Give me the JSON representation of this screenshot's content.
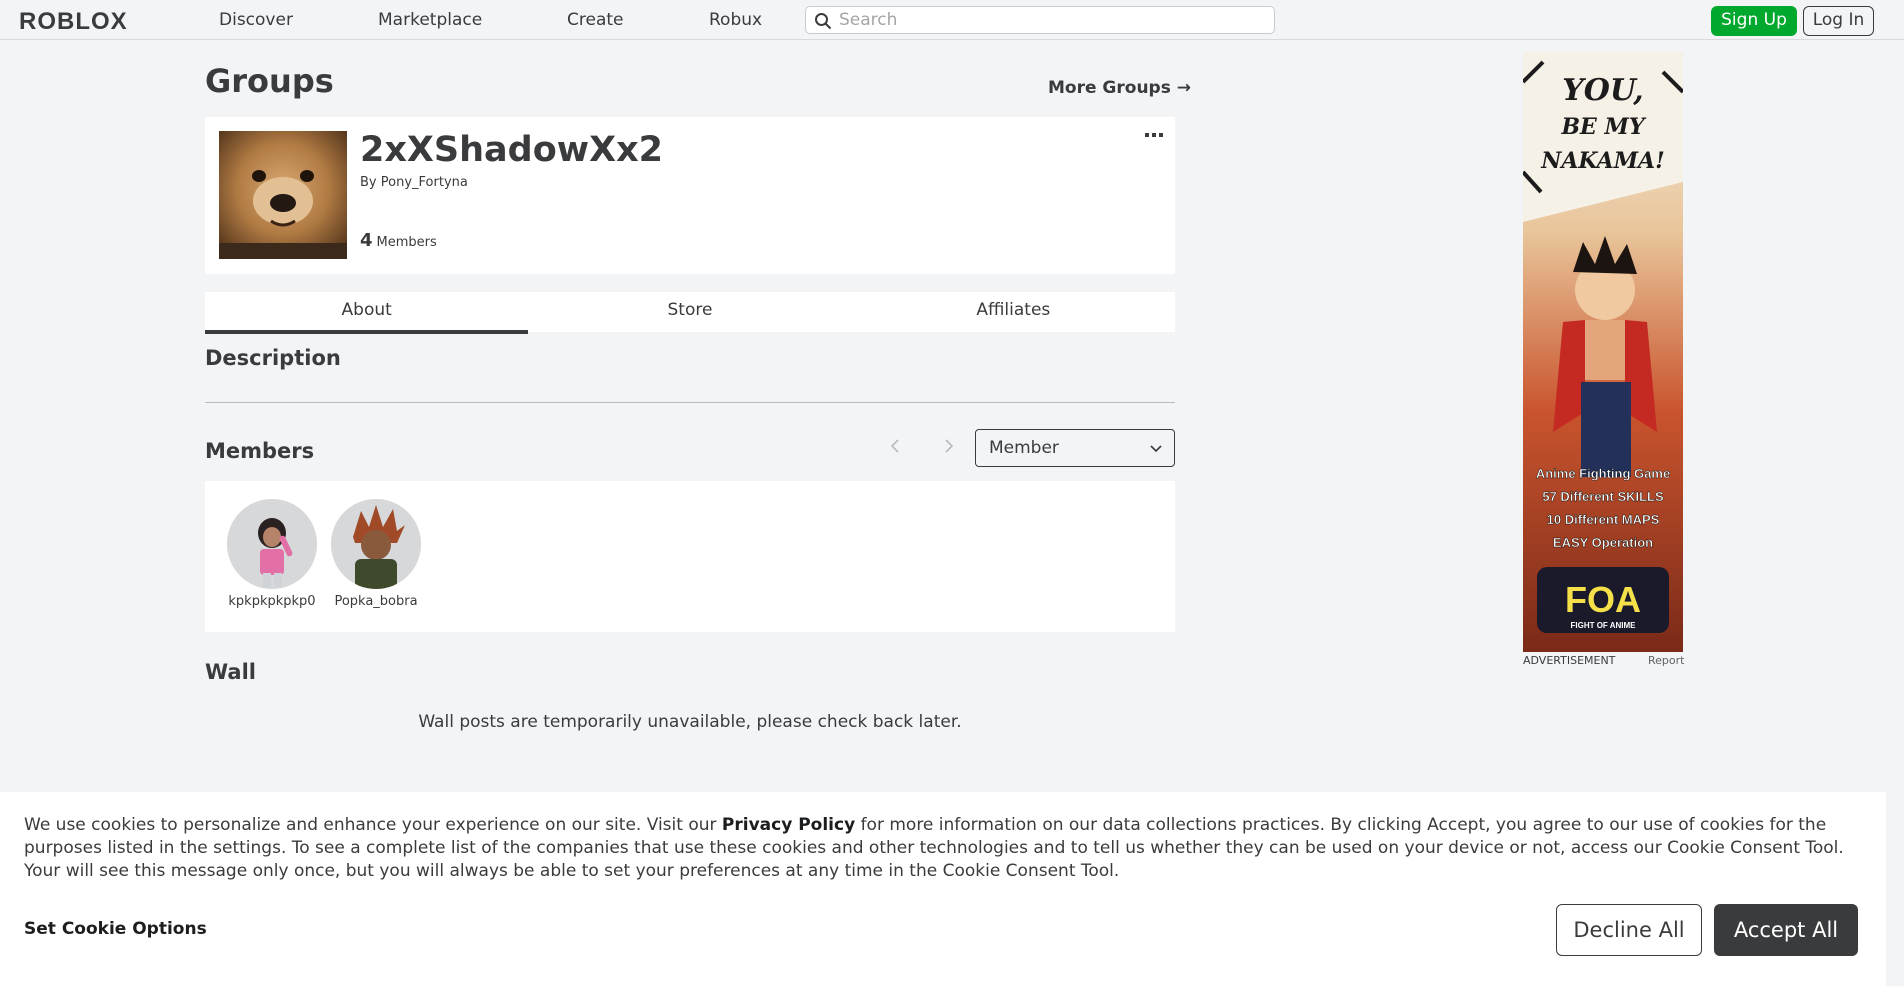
{
  "nav": {
    "logo": "ROBLOX",
    "links": [
      "Discover",
      "Marketplace",
      "Create",
      "Robux"
    ],
    "search_placeholder": "Search",
    "signup": "Sign Up",
    "login": "Log In"
  },
  "page": {
    "title": "Groups",
    "more_groups": "More Groups →"
  },
  "group": {
    "name": "2xXShadowXx2",
    "by_prefix": "By",
    "owner": "Pony_Fortyna",
    "member_count": "4",
    "member_label": "Members"
  },
  "tabs": [
    "About",
    "Store",
    "Affiliates"
  ],
  "active_tab": "About",
  "about": {
    "description_heading": "Description",
    "members_heading": "Members",
    "role_select": "Member",
    "members": [
      {
        "name": "kpkpkpkpkp0"
      },
      {
        "name": "Popka_bobra"
      }
    ],
    "wall_heading": "Wall",
    "wall_message": "Wall posts are temporarily unavailable, please check back later."
  },
  "ad": {
    "headline": [
      "YOU,",
      "BE MY",
      "NAKAMA!"
    ],
    "bullets": [
      "Anime Fighting Game",
      "57 Different SKILLS",
      "10 Different MAPS",
      "EASY Operation"
    ],
    "brand": "FOA",
    "brand_sub": "FIGHT OF ANIME",
    "label": "ADVERTISEMENT",
    "report": "Report"
  },
  "cookie": {
    "text_before": "We use cookies to personalize and enhance your experience on our site. Visit our ",
    "privacy_link": "Privacy Policy",
    "text_after": " for more information on our data collections practices. By clicking Accept, you agree to our use of cookies for the purposes listed in the settings. To see a complete list of the companies that use these cookies and other technologies and to tell us whether they can be used on your device or not, access our Cookie Consent Tool. Your will see this message only once, but you will always be able to set your preferences at any time in the Cookie Consent Tool.",
    "set_options": "Set Cookie Options",
    "decline": "Decline All",
    "accept": "Accept All"
  }
}
